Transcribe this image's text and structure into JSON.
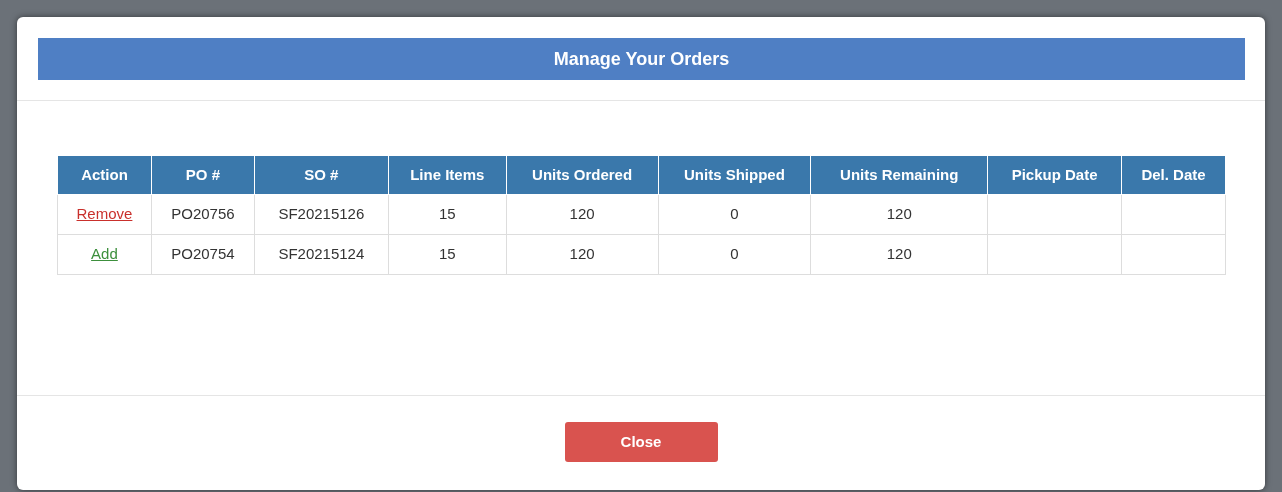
{
  "dialog": {
    "title": "Manage Your Orders",
    "table": {
      "columns": [
        "Action",
        "PO #",
        "SO #",
        "Line Items",
        "Units Ordered",
        "Units Shipped",
        "Units Remaining",
        "Pickup Date",
        "Del. Date"
      ],
      "rows": [
        {
          "kind": "remove",
          "cells": [
            "Remove",
            "PO20756",
            "SF20215126",
            "15",
            "120",
            "0",
            "120",
            "",
            ""
          ]
        },
        {
          "kind": "add",
          "cells": [
            "Add",
            "PO20754",
            "SF20215124",
            "15",
            "120",
            "0",
            "120",
            "",
            ""
          ]
        }
      ]
    },
    "close_button": "Close"
  }
}
